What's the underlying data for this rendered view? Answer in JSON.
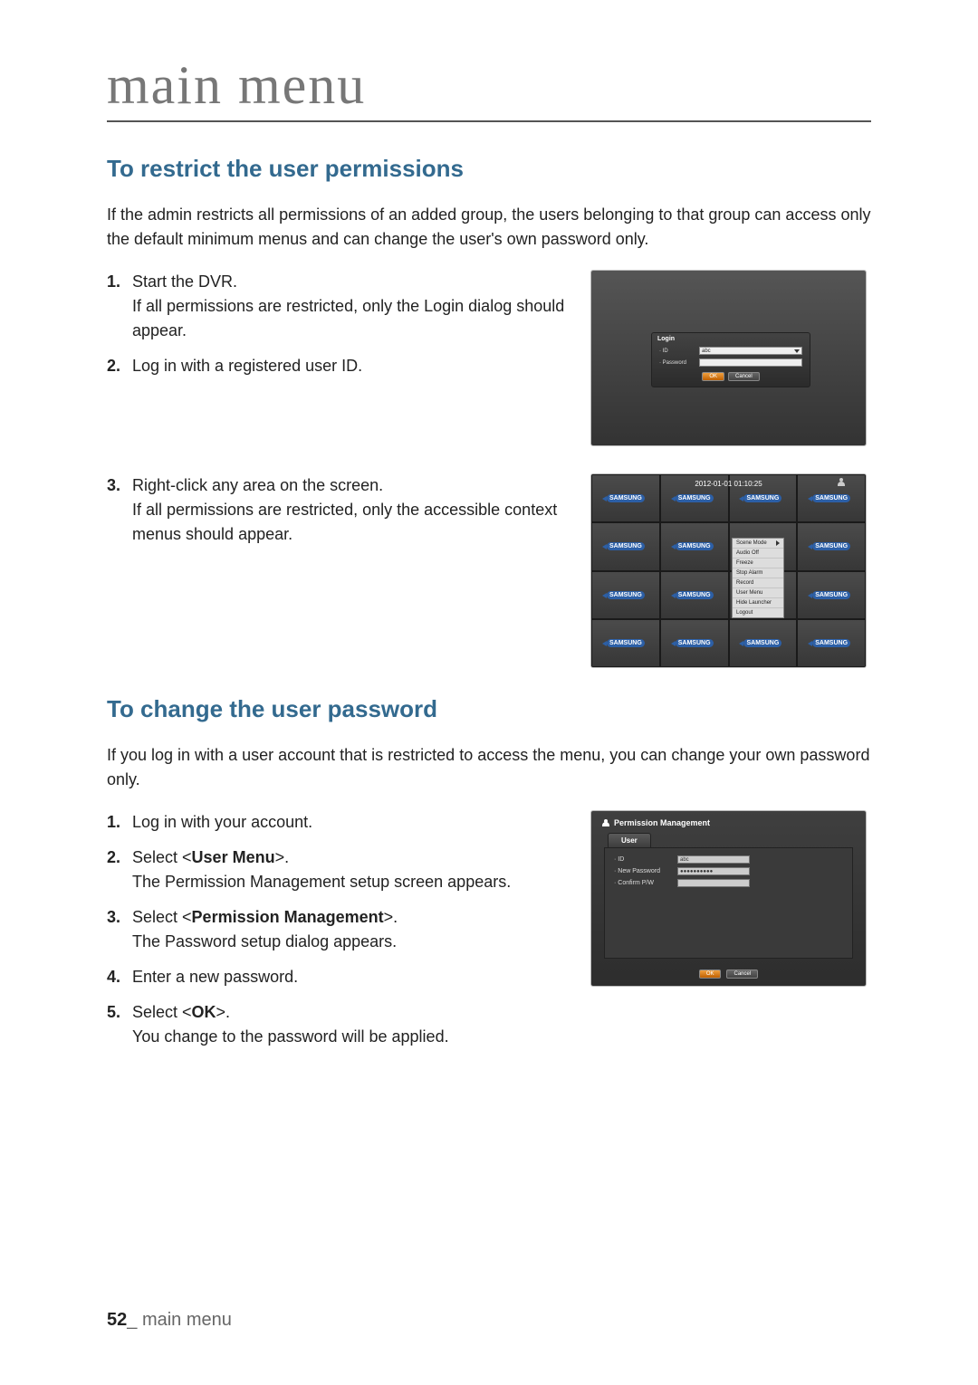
{
  "chapter": "main menu",
  "section1": {
    "title": "To restrict the user permissions",
    "intro": "If the admin restricts all permissions of an added group, the users belonging to that group can access only the default minimum menus and can change the user's own password only.",
    "steps": [
      {
        "main": "Start the DVR.",
        "sub": "If all permissions are restricted, only the Login dialog should appear."
      },
      {
        "main": "Log in with a registered user ID."
      },
      {
        "main": "Right-click any area on the screen.",
        "sub": "If all permissions are restricted, only the accessible context menus should appear."
      }
    ]
  },
  "login": {
    "title": "Login",
    "id_label": "· ID",
    "pw_label": "· Password",
    "id_value": "abc",
    "ok": "OK",
    "cancel": "Cancel"
  },
  "grid": {
    "timestamp": "2012-01-01 01:10:25",
    "cell_label": "SAMSUNG",
    "context_items": [
      "Scene Mode",
      "Audio Off",
      "Freeze",
      "Stop Alarm",
      "Record",
      "User Menu",
      "Hide Launcher",
      "Logout"
    ]
  },
  "section2": {
    "title": "To change the user password",
    "intro": "If you log in with a user account that is restricted to access the menu, you can change your own password only.",
    "steps": [
      {
        "main": "Log in with your account."
      },
      {
        "prefix": "Select <",
        "bold": "User Menu",
        "suffix": ">.",
        "sub": "The Permission Management setup screen appears."
      },
      {
        "prefix": "Select <",
        "bold": "Permission Management",
        "suffix": ">.",
        "sub": "The Password setup dialog appears."
      },
      {
        "main": "Enter a new password."
      },
      {
        "prefix": "Select <",
        "bold": "OK",
        "suffix": ">.",
        "sub": "You change to the password will be applied."
      }
    ]
  },
  "pm": {
    "header": "Permission Management",
    "tab": "User",
    "id_label": "· ID",
    "new_pw_label": "· New Password",
    "confirm_label": "· Confirm P/W",
    "id_value": "abc",
    "pw_mask": "●●●●●●●●●●",
    "ok": "OK",
    "cancel": "Cancel"
  },
  "footer": {
    "page": "52",
    "sep": "_ ",
    "label": "main menu"
  }
}
